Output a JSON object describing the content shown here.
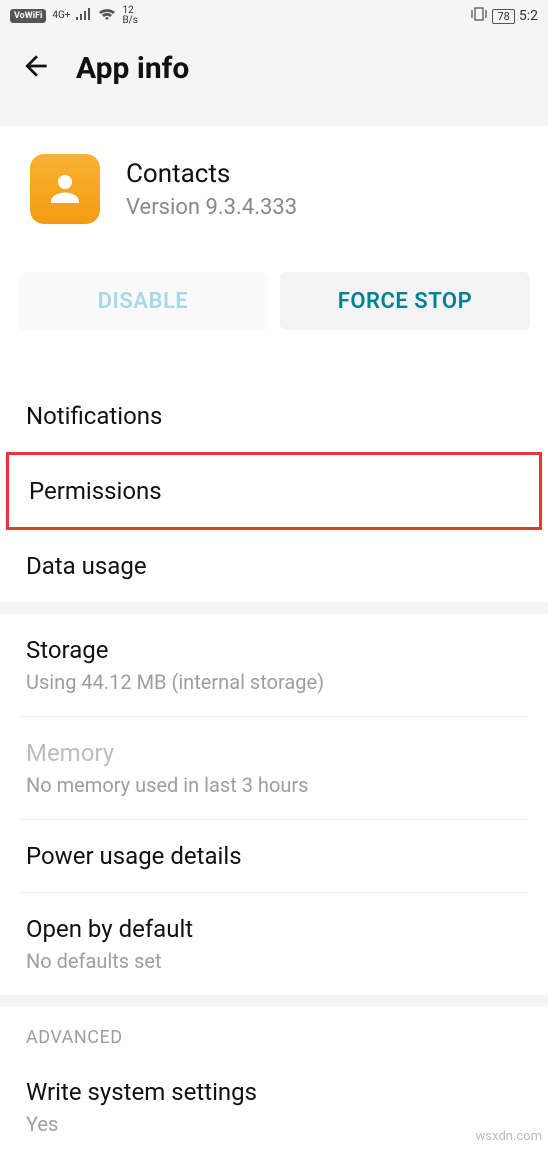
{
  "status": {
    "vowifi": "VoWiFi",
    "net_top": "4G+",
    "speed_top": "12",
    "speed_bottom": "B/s",
    "battery": "78",
    "time": "5:2"
  },
  "header": {
    "title": "App info"
  },
  "app": {
    "name": "Contacts",
    "version": "Version 9.3.4.333"
  },
  "buttons": {
    "disable": "DISABLE",
    "force_stop": "FORCE STOP"
  },
  "section1": {
    "notifications": "Notifications",
    "permissions": "Permissions",
    "data_usage": "Data usage"
  },
  "section2": {
    "storage_title": "Storage",
    "storage_sub": "Using 44.12 MB (internal storage)",
    "memory_title": "Memory",
    "memory_sub": "No memory used in last 3 hours",
    "power": "Power usage details",
    "open_default_title": "Open by default",
    "open_default_sub": "No defaults set"
  },
  "section3": {
    "header": "ADVANCED",
    "write_title": "Write system settings",
    "write_sub": "Yes"
  },
  "watermark": "wsxdn.com"
}
